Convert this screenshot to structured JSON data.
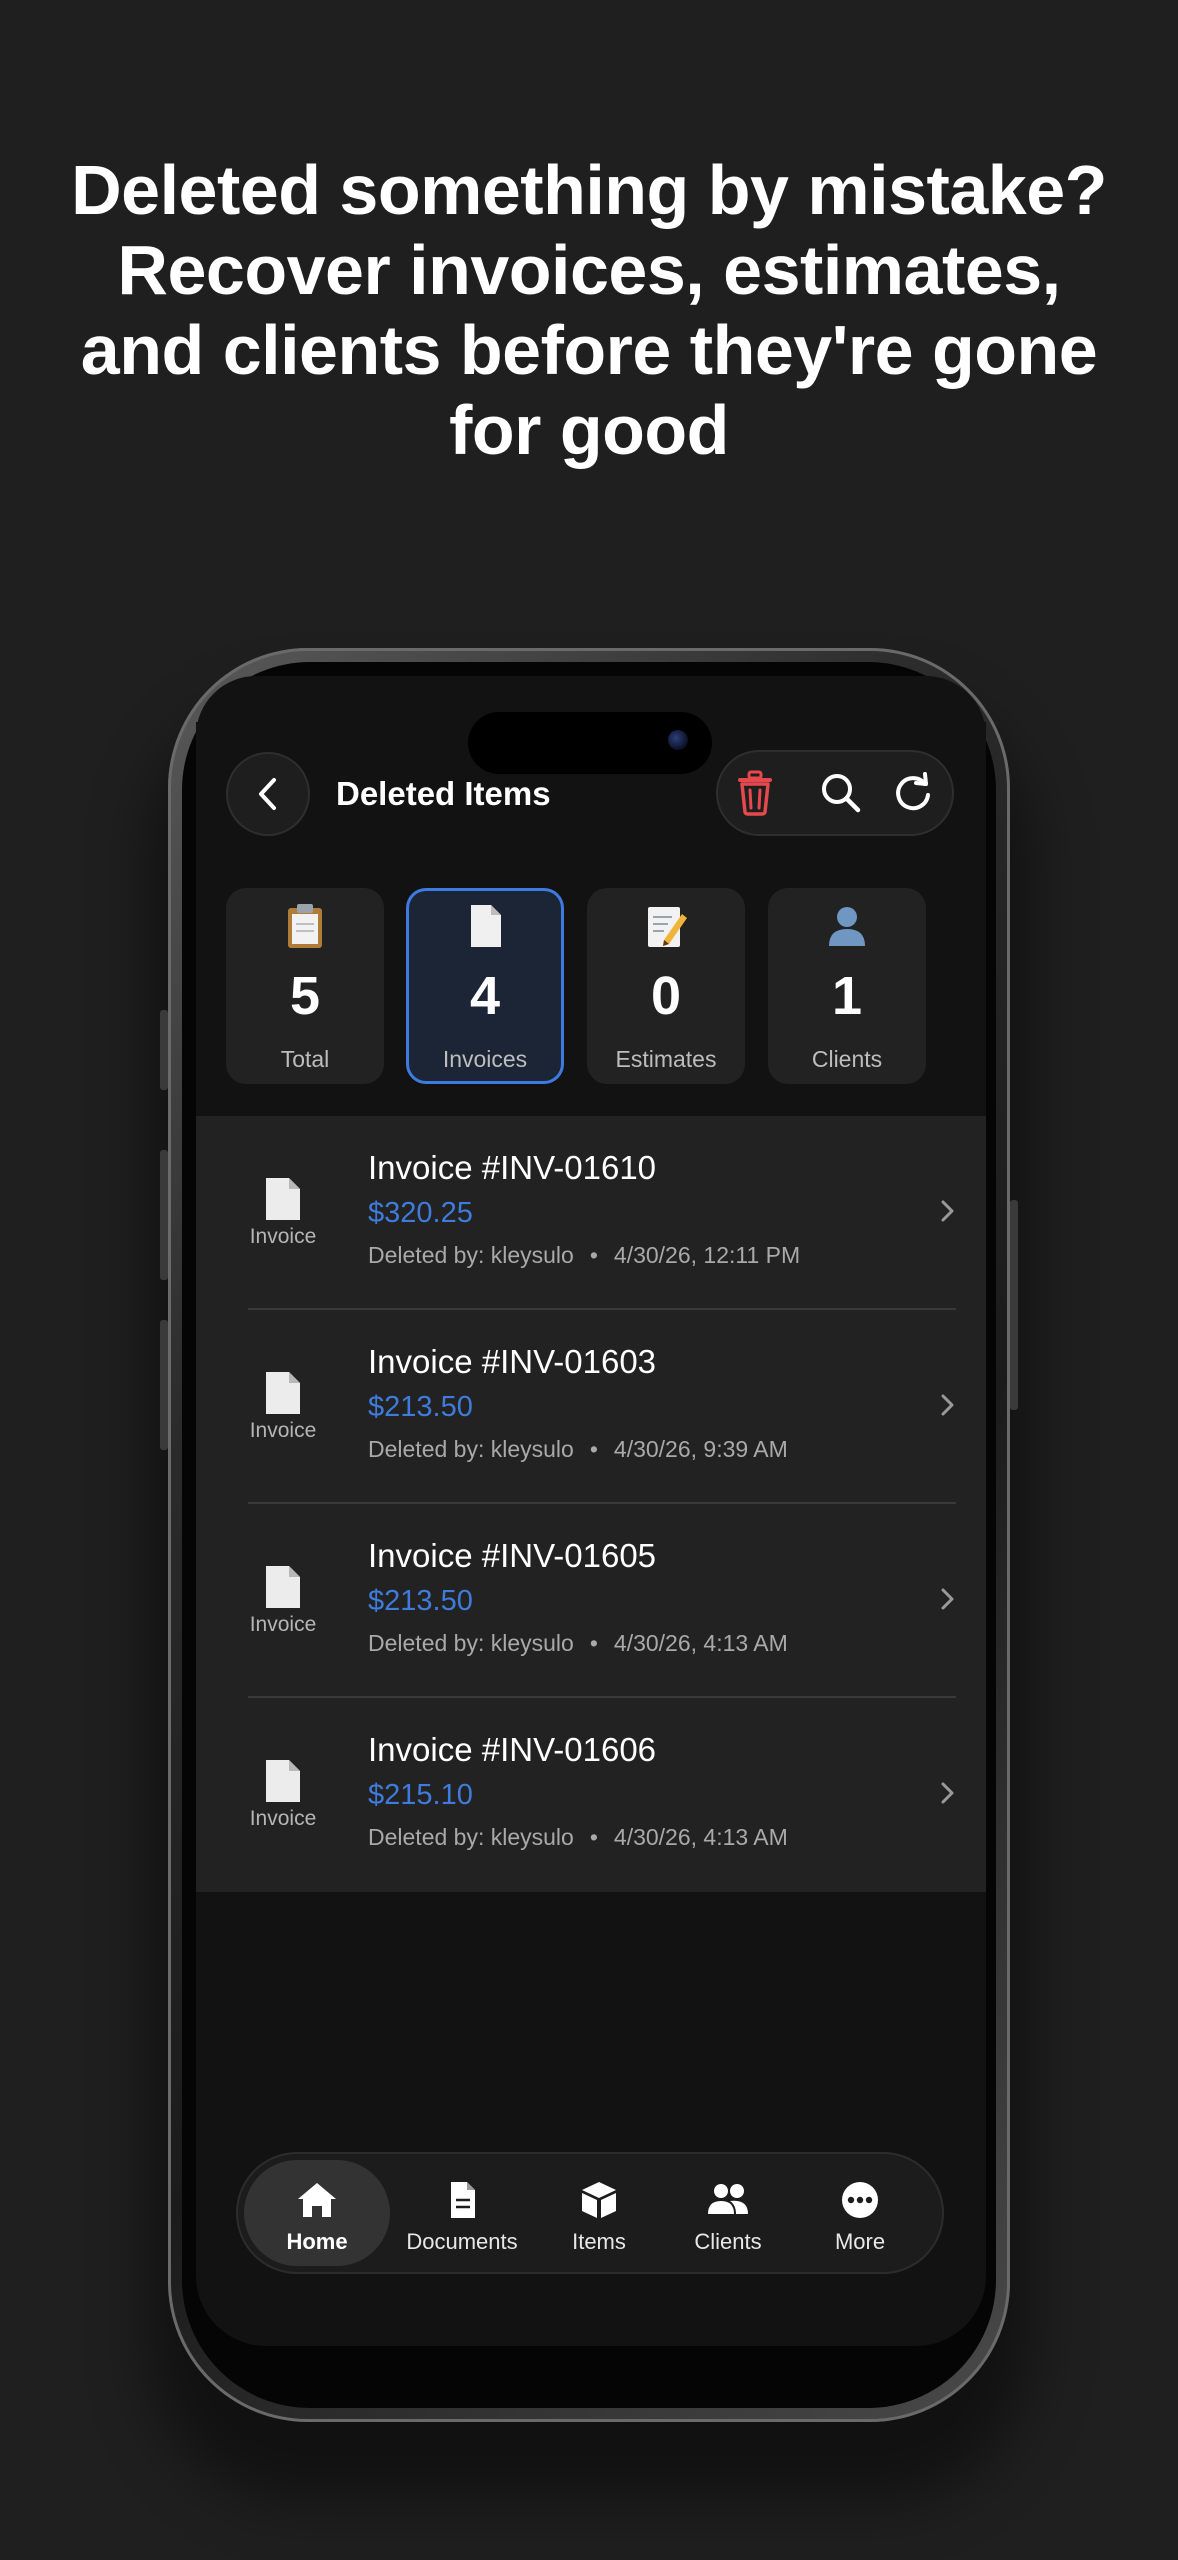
{
  "headline": {
    "lines": [
      "Deleted something by mistake?",
      "Recover invoices, estimates,",
      "and clients before they're gone",
      "for good"
    ]
  },
  "header": {
    "title": "Deleted Items",
    "back_icon": "chevron-left-icon",
    "actions": [
      "trash-icon",
      "search-icon",
      "refresh-icon"
    ]
  },
  "stats": [
    {
      "icon": "clipboard-icon",
      "value": "5",
      "label": "Total",
      "active": false
    },
    {
      "icon": "document-icon",
      "value": "4",
      "label": "Invoices",
      "active": true
    },
    {
      "icon": "memo-icon",
      "value": "0",
      "label": "Estimates",
      "active": false
    },
    {
      "icon": "person-icon",
      "value": "1",
      "label": "Clients",
      "active": false
    }
  ],
  "items": [
    {
      "type_label": "Invoice",
      "title": "Invoice #INV-01610",
      "amount": "$320.25",
      "deleted_by": "Deleted by: kleysulo",
      "separator": "•",
      "timestamp": "4/30/26, 12:11 PM"
    },
    {
      "type_label": "Invoice",
      "title": "Invoice #INV-01603",
      "amount": "$213.50",
      "deleted_by": "Deleted by: kleysulo",
      "separator": "•",
      "timestamp": "4/30/26, 9:39 AM"
    },
    {
      "type_label": "Invoice",
      "title": "Invoice #INV-01605",
      "amount": "$213.50",
      "deleted_by": "Deleted by: kleysulo",
      "separator": "•",
      "timestamp": "4/30/26, 4:13 AM"
    },
    {
      "type_label": "Invoice",
      "title": "Invoice #INV-01606",
      "amount": "$215.10",
      "deleted_by": "Deleted by: kleysulo",
      "separator": "•",
      "timestamp": "4/30/26, 4:13 AM"
    }
  ],
  "tabbar": {
    "tabs": [
      {
        "label": "Home",
        "icon": "home-icon",
        "active": true
      },
      {
        "label": "Documents",
        "icon": "document-icon",
        "active": false
      },
      {
        "label": "Items",
        "icon": "box-icon",
        "active": false
      },
      {
        "label": "Clients",
        "icon": "users-icon",
        "active": false
      },
      {
        "label": "More",
        "icon": "more-icon",
        "active": false
      }
    ]
  },
  "colors": {
    "background": "#1f1f1f",
    "accent": "#3d7be0",
    "amount": "#3f7bdc",
    "danger": "#e5484d"
  }
}
